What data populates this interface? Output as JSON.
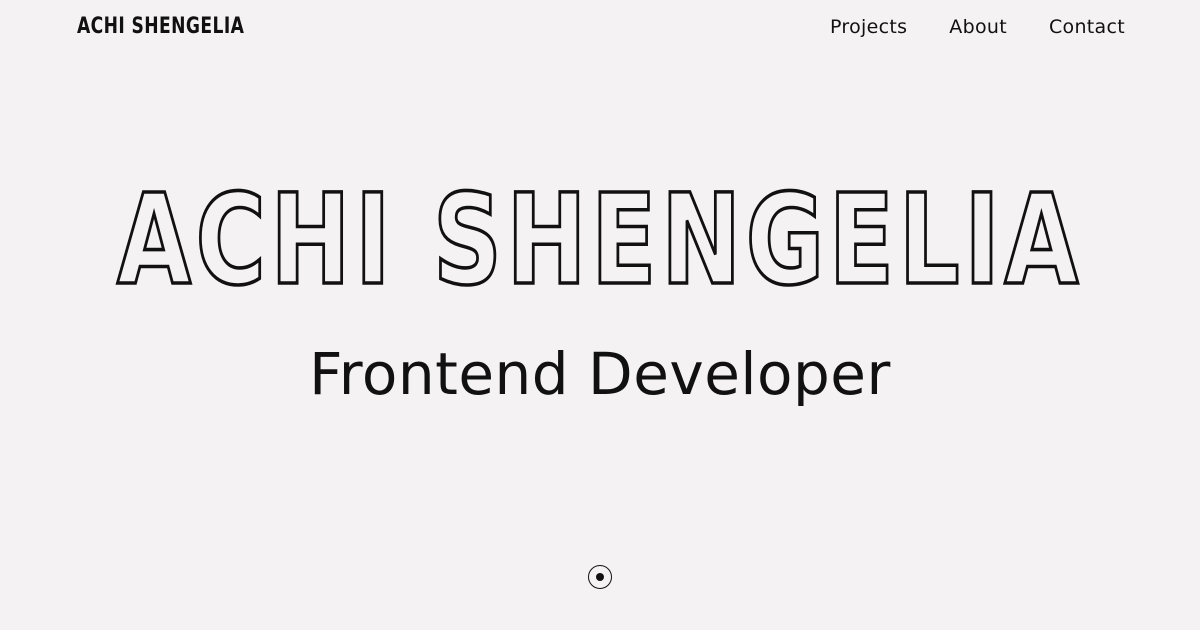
{
  "header": {
    "logo_text": "ACHI SHENGELIA",
    "nav": [
      {
        "label": "Projects"
      },
      {
        "label": "About"
      },
      {
        "label": "Contact"
      }
    ]
  },
  "hero": {
    "title": "ACHI SHENGELIA",
    "subtitle": "Frontend Developer"
  },
  "scroll_indicator": {
    "icon": "scroll-down-indicator-icon"
  },
  "colors": {
    "background": "#f4f2f3",
    "text": "#111111"
  }
}
